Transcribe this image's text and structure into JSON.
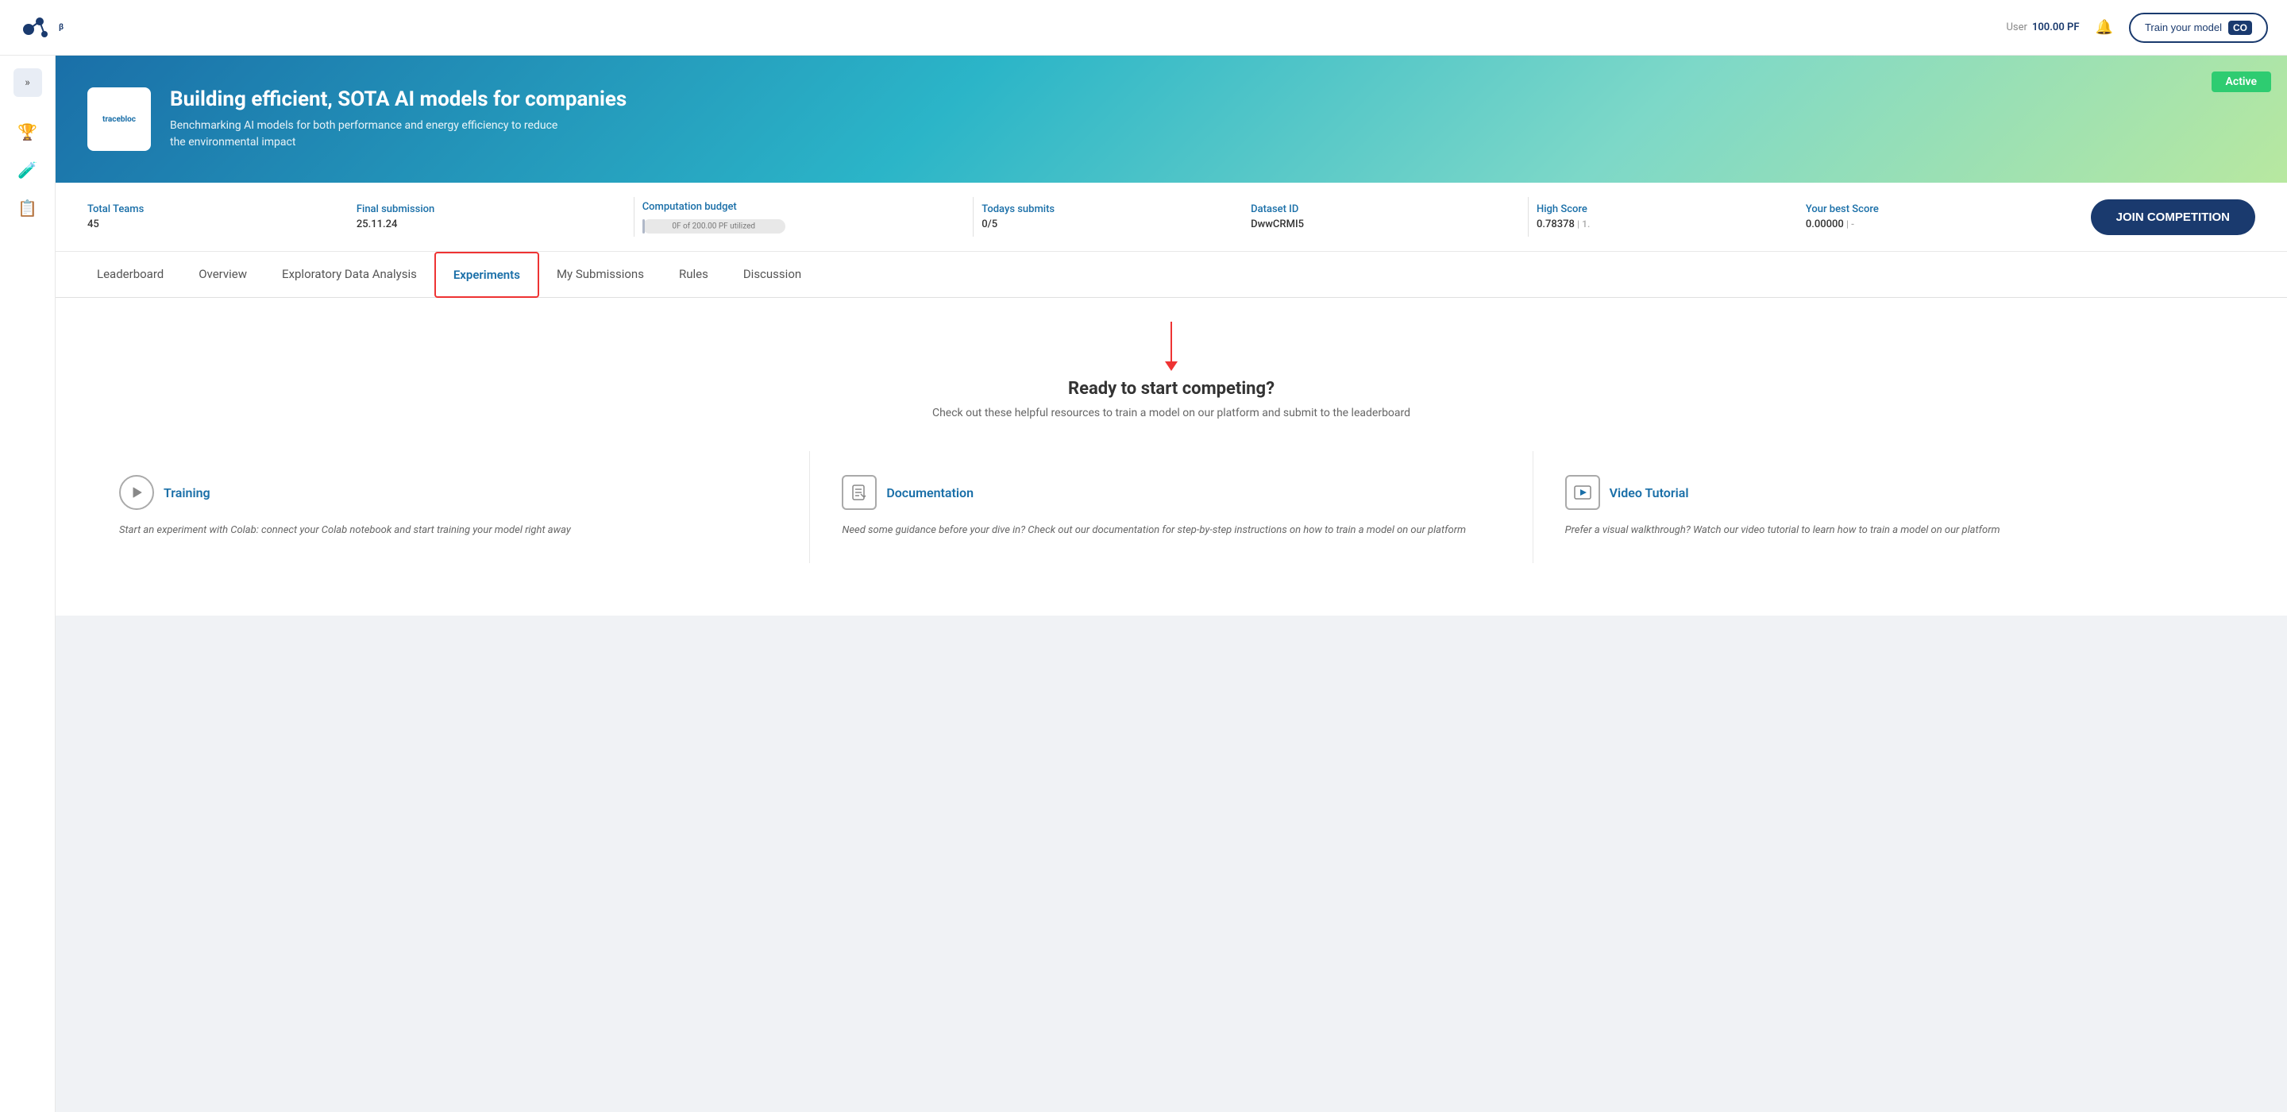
{
  "topNav": {
    "logo_text": "tracebloc",
    "beta_label": "β",
    "user_label": "User",
    "pf_balance": "100.00 PF",
    "train_btn_label": "Train your model",
    "train_btn_icon": "CO"
  },
  "sidebar": {
    "toggle_icon": "»",
    "icons": [
      "cup",
      "flask",
      "document"
    ]
  },
  "banner": {
    "logo_text": "tracebloc",
    "title": "Building efficient, SOTA AI models for companies",
    "subtitle": "Benchmarking AI models for both performance and energy efficiency to reduce the environmental impact",
    "active_badge": "Active"
  },
  "stats": {
    "total_teams_label": "Total Teams",
    "total_teams_value": "45",
    "final_submission_label": "Final submission",
    "final_submission_value": "25.11.24",
    "computation_budget_label": "Computation budget",
    "budget_bar_label": "0F of 200.00 PF utilized",
    "todays_submits_label": "Todays submits",
    "todays_submits_value": "0/5",
    "dataset_id_label": "Dataset ID",
    "dataset_id_value": "DwwCRMI5",
    "high_score_label": "High Score",
    "high_score_value": "0.78378",
    "high_score_suffix": "| 1.",
    "your_best_score_label": "Your best Score",
    "your_best_score_value": "0.00000",
    "your_best_score_suffix": "| -",
    "join_btn_label": "JOIN COMPETITION"
  },
  "tabs": {
    "items": [
      {
        "id": "leaderboard",
        "label": "Leaderboard"
      },
      {
        "id": "overview",
        "label": "Overview"
      },
      {
        "id": "eda",
        "label": "Exploratory Data Analysis"
      },
      {
        "id": "experiments",
        "label": "Experiments",
        "active": true
      },
      {
        "id": "my-submissions",
        "label": "My Submissions"
      },
      {
        "id": "rules",
        "label": "Rules"
      },
      {
        "id": "discussion",
        "label": "Discussion"
      }
    ]
  },
  "experimentsContent": {
    "ready_title": "Ready to start competing?",
    "ready_subtitle": "Check out these helpful resources to train a model on our platform and submit to the leaderboard",
    "resources": [
      {
        "id": "training",
        "icon_type": "circle-play",
        "title": "Training",
        "description": "Start an experiment with Colab: connect your Colab notebook and start training your model right away"
      },
      {
        "id": "documentation",
        "icon_type": "doc",
        "title": "Documentation",
        "description": "Need some guidance before your dive in? Check out our documentation for step-by-step instructions on how to train a model on our platform"
      },
      {
        "id": "video-tutorial",
        "icon_type": "video",
        "title": "Video Tutorial",
        "description": "Prefer a visual walkthrough? Watch our video tutorial to learn how to train a model on our platform"
      }
    ]
  }
}
